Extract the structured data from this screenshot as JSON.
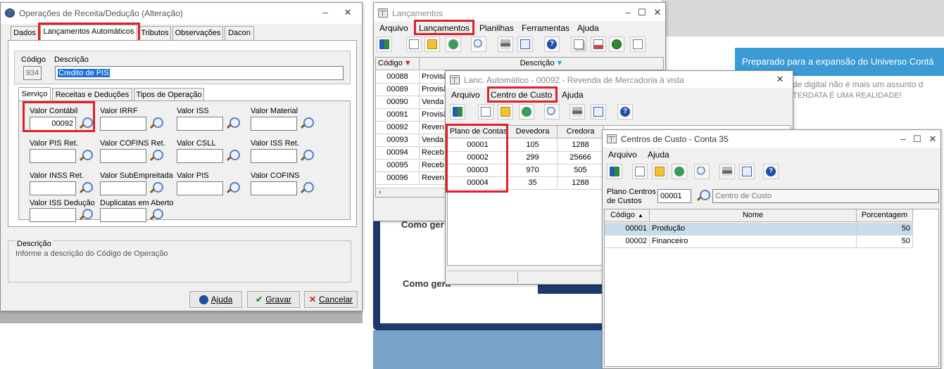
{
  "background": {
    "banner_text": "Preparado para a expansão do Universo Contá",
    "text_line1": "de digital não é mais um assunto d",
    "text_line2": "TERDATA É UMA REALIDADE!",
    "como1": "Como ger",
    "como2": "Como gera",
    "banner_color": "#3a9bd5",
    "dark_color": "#1e3a6b"
  },
  "win1": {
    "title": "Operações de Receita/Dedução (Alteração)",
    "tabs": [
      "Dados",
      "Lançamentos Automáticos",
      "Tributos",
      "Observações",
      "Dacon"
    ],
    "codigo_label": "Código",
    "descricao_label": "Descrição",
    "codigo_value": "934",
    "descricao_value": "Credito de PIS",
    "subtabs": [
      "Serviço",
      "Receitas e Deduções",
      "Tipos de Operação"
    ],
    "fields": [
      {
        "label": "Valor Contábil",
        "value": "00092"
      },
      {
        "label": "Valor IRRF",
        "value": ""
      },
      {
        "label": "Valor ISS",
        "value": ""
      },
      {
        "label": "Valor Material",
        "value": ""
      },
      {
        "label": "Valor PIS Ret.",
        "value": ""
      },
      {
        "label": "Valor COFINS Ret.",
        "value": ""
      },
      {
        "label": "Valor CSLL",
        "value": ""
      },
      {
        "label": "Valor ISS Ret.",
        "value": ""
      },
      {
        "label": "Valor INSS Ret.",
        "value": ""
      },
      {
        "label": "Valor SubEmpreitada",
        "value": ""
      },
      {
        "label": "Valor PIS",
        "value": ""
      },
      {
        "label": "Valor COFINS",
        "value": ""
      },
      {
        "label": "Valor ISS Dedução",
        "value": ""
      },
      {
        "label": "Duplicatas em Aberto",
        "value": ""
      }
    ],
    "descricao_group_label": "Descrição",
    "descricao_help": "Informe a descrição do Código de Operação",
    "btn_ajuda": "Ajuda",
    "btn_gravar": "Gravar",
    "btn_cancelar": "Cancelar"
  },
  "win2": {
    "title": "Lançamentos",
    "menu": [
      "Arquivo",
      "Lançamentos",
      "Planilhas",
      "Ferramentas",
      "Ajuda"
    ],
    "col_codigo": "Código",
    "col_descricao": "Descrição",
    "rows": [
      {
        "codigo": "00088",
        "descricao": "Provisã"
      },
      {
        "codigo": "00089",
        "descricao": "Provisã"
      },
      {
        "codigo": "00090",
        "descricao": "Venda"
      },
      {
        "codigo": "00091",
        "descricao": "Provisã"
      },
      {
        "codigo": "00092",
        "descricao": "Reven"
      },
      {
        "codigo": "00093",
        "descricao": "Venda"
      },
      {
        "codigo": "00094",
        "descricao": "Receb"
      },
      {
        "codigo": "00095",
        "descricao": "Receb"
      },
      {
        "codigo": "00096",
        "descricao": "Reven"
      }
    ]
  },
  "win3": {
    "title": "Lanc. Automático - 00092 - Revenda de Mercadoria à vista",
    "menu": [
      "Arquivo",
      "Centro de Custo",
      "Ajuda"
    ],
    "headers": [
      "Plano de Contas",
      "Devedora",
      "Credora"
    ],
    "rows": [
      {
        "plano": "00001",
        "devedora": "105",
        "credora": "1288"
      },
      {
        "plano": "00002",
        "devedora": "299",
        "credora": "25666"
      },
      {
        "plano": "00003",
        "devedora": "970",
        "credora": "505"
      },
      {
        "plano": "00004",
        "devedora": "35",
        "credora": "1288"
      }
    ]
  },
  "win4": {
    "title": "Centros de Custo - Conta 35",
    "menu": [
      "Arquivo",
      "Ajuda"
    ],
    "plano_label_1": "Plano Centros",
    "plano_label_2": "de Custos",
    "plano_value": "00001",
    "centro_placeholder": "Centro de Custo",
    "headers": [
      "Código",
      "Nome",
      "Porcentagem"
    ],
    "rows": [
      {
        "codigo": "00001",
        "nome": "Produção",
        "pct": "50"
      },
      {
        "codigo": "00002",
        "nome": "Financeiro",
        "pct": "50"
      }
    ]
  }
}
